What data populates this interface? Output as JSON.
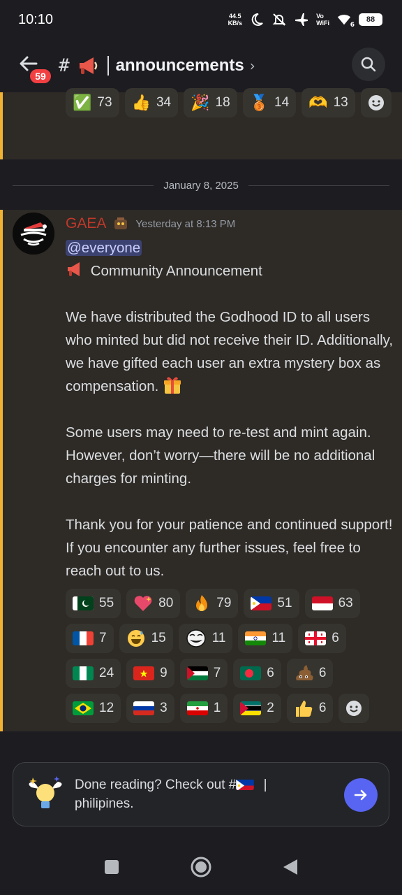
{
  "status": {
    "time": "10:10",
    "net_speed_value": "44.5",
    "net_speed_unit": "KB/s",
    "volte_top": "Vo",
    "volte_bottom": "WiFi",
    "wifi_sub": "6",
    "battery": "88"
  },
  "header": {
    "badge": "59",
    "channel_name": "announcements",
    "icons": [
      "back-arrow-icon",
      "hash-icon",
      "megaphone-icon",
      "chevron-right-icon",
      "search-icon"
    ]
  },
  "prev_reactions": [
    {
      "emoji": "✅",
      "count": "73"
    },
    {
      "emoji": "👍",
      "count": "34"
    },
    {
      "emoji": "🎉",
      "count": "18"
    },
    {
      "emoji": "🥉",
      "count": "14"
    },
    {
      "emoji": "🫶",
      "count": "13"
    }
  ],
  "date_separator": "January 8, 2025",
  "message": {
    "author": "GAEA",
    "timestamp": "Yesterday at 8:13 PM",
    "mention": "@everyone",
    "title": "Community Announcement",
    "p1": "We have distributed the Godhood ID to all users who minted but did not receive their ID. Additionally, we have gifted each user an extra mystery box as compensation.",
    "p2": "Some users may need to re-test and mint again. However, don’t worry—there will be no additional charges for minting.",
    "p3": "Thank you for your patience and continued support! If you encounter any further issues, feel free to reach out to us."
  },
  "reactions": [
    {
      "kind": "pakistan-flag",
      "count": "55"
    },
    {
      "kind": "sparkling-heart",
      "count": "80"
    },
    {
      "kind": "fire",
      "count": "79"
    },
    {
      "kind": "philippines-flag",
      "count": "51"
    },
    {
      "kind": "indonesia-flag",
      "count": "63"
    },
    {
      "kind": "france-flag",
      "count": "7"
    },
    {
      "kind": "sweat-smile",
      "count": "15"
    },
    {
      "kind": "troll-face",
      "count": "11"
    },
    {
      "kind": "india-flag",
      "count": "11"
    },
    {
      "kind": "georgia-flag",
      "count": "6"
    },
    {
      "kind": "nigeria-flag",
      "count": "24"
    },
    {
      "kind": "vietnam-flag",
      "count": "9"
    },
    {
      "kind": "palestine-flag",
      "count": "7"
    },
    {
      "kind": "bangladesh-flag",
      "count": "6"
    },
    {
      "kind": "poop",
      "count": "6"
    },
    {
      "kind": "brazil-flag",
      "count": "12"
    },
    {
      "kind": "russia-flag",
      "count": "3"
    },
    {
      "kind": "iran-flag",
      "count": "1"
    },
    {
      "kind": "mozambique-flag",
      "count": "2"
    },
    {
      "kind": "thumbs-up",
      "count": "6"
    }
  ],
  "composer": {
    "line1": "Done reading? Check out #",
    "line1_suffix": "|",
    "line2": "philipines."
  },
  "colors": {
    "accent": "#f0b232",
    "blurple": "#5865f2",
    "author": "#c0392b"
  }
}
